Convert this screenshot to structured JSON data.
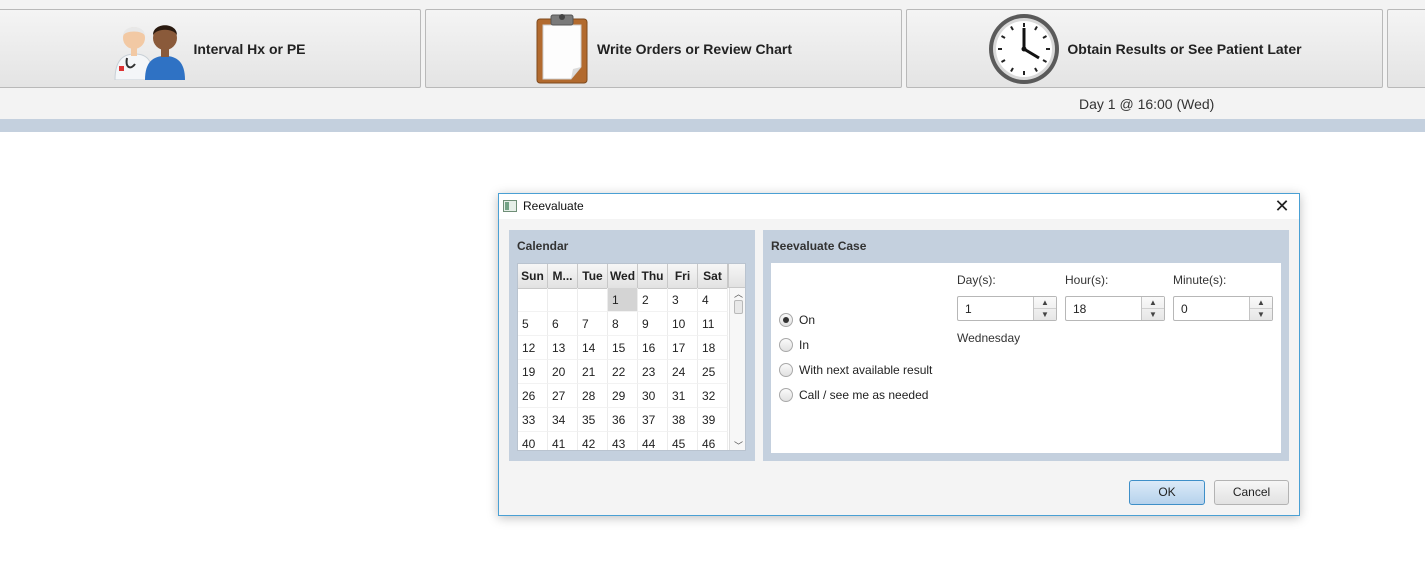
{
  "toolbar": {
    "btn1_label": "Interval Hx or PE",
    "btn2_label": "Write Orders or Review Chart",
    "btn3_label": "Obtain Results or See Patient Later",
    "day_text": "Day 1 @ 16:00 (Wed)"
  },
  "dialog": {
    "title": "Reevaluate",
    "calendar": {
      "title": "Calendar",
      "headers": [
        "Sun",
        "M...",
        "Tue",
        "Wed",
        "Thu",
        "Fri",
        "Sat"
      ],
      "selected_day": "1",
      "rows": [
        [
          "",
          "",
          "",
          "1",
          "2",
          "3",
          "4"
        ],
        [
          "5",
          "6",
          "7",
          "8",
          "9",
          "10",
          "11"
        ],
        [
          "12",
          "13",
          "14",
          "15",
          "16",
          "17",
          "18"
        ],
        [
          "19",
          "20",
          "21",
          "22",
          "23",
          "24",
          "25"
        ],
        [
          "26",
          "27",
          "28",
          "29",
          "30",
          "31",
          "32"
        ],
        [
          "33",
          "34",
          "35",
          "36",
          "37",
          "38",
          "39"
        ],
        [
          "40",
          "41",
          "42",
          "43",
          "44",
          "45",
          "46"
        ]
      ]
    },
    "case": {
      "title": "Reevaluate Case",
      "options": [
        {
          "label": "On",
          "selected": true
        },
        {
          "label": "In",
          "selected": false
        },
        {
          "label": "With next available result",
          "selected": false
        },
        {
          "label": "Call / see me as needed",
          "selected": false
        }
      ],
      "days_label": "Day(s):",
      "hours_label": "Hour(s):",
      "minutes_label": "Minute(s):",
      "days_value": "1",
      "hours_value": "18",
      "minutes_value": "0",
      "weekday": "Wednesday"
    },
    "ok_label": "OK",
    "cancel_label": "Cancel"
  },
  "colors": {
    "panel_bg": "#c4d0de",
    "accent_border": "#4aa0d4",
    "toolbar_bg": "#f3f3f3"
  },
  "icons": [
    "doctor-patient-icon",
    "clipboard-icon",
    "clock-icon",
    "close-icon"
  ]
}
